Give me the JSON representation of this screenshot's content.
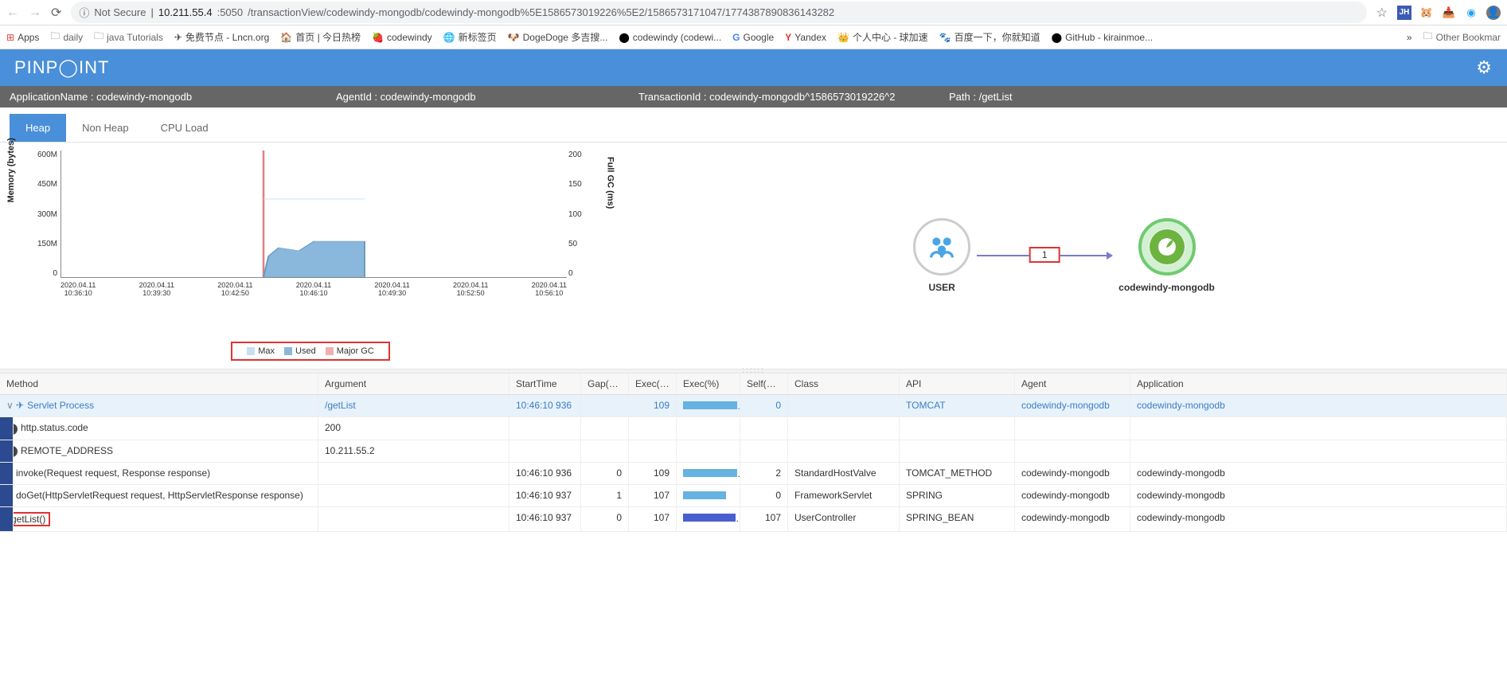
{
  "browser": {
    "not_secure": "Not Secure",
    "url_host": "10.211.55.4",
    "url_port": ":5050",
    "url_path": "/transactionView/codewindy-mongodb/codewindy-mongodb%5E1586573019226%5E2/1586573171047/1774387890836143282"
  },
  "bookmarks": {
    "apps": "Apps",
    "daily": "daily",
    "java": "java Tutorials",
    "free": "免费节点 - Lncn.org",
    "home": "首页 | 今日热榜",
    "codewindy": "codewindy",
    "newtab": "新标签页",
    "dogedoge": "DogeDoge 多吉搜...",
    "codewindy_gh": "codewindy (codewi...",
    "google": "Google",
    "yandex": "Yandex",
    "personal": "个人中心 - 球加速",
    "baidu": "百度一下，你就知道",
    "github": "GitHub - kirainmoe...",
    "other": "Other Bookmar"
  },
  "pp_logo": "PINP◯INT",
  "info": {
    "app_label": "ApplicationName : ",
    "app_value": "codewindy-mongodb",
    "agent_label": "AgentId : ",
    "agent_value": "codewindy-mongodb",
    "txn_label": "TransactionId : ",
    "txn_value": "codewindy-mongodb^1586573019226^2",
    "path_label": "Path : ",
    "path_value": "/getList"
  },
  "tabs": {
    "heap": "Heap",
    "nonheap": "Non Heap",
    "cpu": "CPU Load"
  },
  "chart_data": {
    "type": "area",
    "ylabel": "Memory (bytes)",
    "y2label": "Full GC (ms)",
    "y_ticks": [
      "600M",
      "450M",
      "300M",
      "150M",
      "0"
    ],
    "y2_ticks": [
      "200",
      "150",
      "100",
      "50",
      "0"
    ],
    "x_ticks": [
      {
        "d": "2020.04.11",
        "t": "10:36:10"
      },
      {
        "d": "2020.04.11",
        "t": "10:39:30"
      },
      {
        "d": "2020.04.11",
        "t": "10:42:50"
      },
      {
        "d": "2020.04.11",
        "t": "10:46:10"
      },
      {
        "d": "2020.04.11",
        "t": "10:49:30"
      },
      {
        "d": "2020.04.11",
        "t": "10:52:50"
      },
      {
        "d": "2020.04.11",
        "t": "10:56:10"
      }
    ],
    "series": [
      {
        "name": "Max",
        "color": "#c8dff2"
      },
      {
        "name": "Used",
        "color": "#8ab8dd"
      },
      {
        "name": "Major GC",
        "color": "#f0b0b0"
      }
    ],
    "used_approx": [
      {
        "x": 0.4,
        "y": 0
      },
      {
        "x": 0.41,
        "y": 100
      },
      {
        "x": 0.43,
        "y": 140
      },
      {
        "x": 0.47,
        "y": 125
      },
      {
        "x": 0.5,
        "y": 170
      },
      {
        "x": 0.6,
        "y": 170
      },
      {
        "x": 0.6,
        "y": 0
      }
    ],
    "ylim": [
      0,
      600
    ],
    "y2lim": [
      0,
      200
    ],
    "max_line_y": 370
  },
  "topo": {
    "user": "USER",
    "target": "codewindy-mongodb",
    "count": "1"
  },
  "table": {
    "headers": {
      "method": "Method",
      "argument": "Argument",
      "start": "StartTime",
      "gap": "Gap(ms)",
      "exms": "Exec(ms)",
      "exp": "Exec(%)",
      "self": "Self(ms)",
      "class": "Class",
      "api": "API",
      "agent": "Agent",
      "app": "Application"
    },
    "rows": [
      {
        "marker": "",
        "indent": 0,
        "caret": "∨",
        "icon": "plane",
        "method": "Servlet Process",
        "arg": "/getList",
        "start": "10:46:10 936",
        "gap": "",
        "exms": "109",
        "exp_w": 68,
        "exp_c": "#66b2e0",
        "self": "0",
        "class": "",
        "api": "TOMCAT",
        "agent": "codewindy-mongodb",
        "app": "codewindy-mongodb",
        "sel": true
      },
      {
        "marker": "blue",
        "indent": 1,
        "caret": "",
        "icon": "info",
        "method": "http.status.code",
        "arg": "200",
        "start": "",
        "gap": "",
        "exms": "",
        "exp_w": 0,
        "exp_c": "",
        "self": "",
        "class": "",
        "api": "",
        "agent": "",
        "app": ""
      },
      {
        "marker": "blue",
        "indent": 1,
        "caret": "",
        "icon": "info",
        "method": "REMOTE_ADDRESS",
        "arg": "10.211.55.2",
        "start": "",
        "gap": "",
        "exms": "",
        "exp_w": 0,
        "exp_c": "",
        "self": "",
        "class": "",
        "api": "",
        "agent": "",
        "app": ""
      },
      {
        "marker": "blue",
        "indent": 1,
        "caret": "∨",
        "icon": "",
        "method": "invoke(Request request, Response response)",
        "arg": "",
        "start": "10:46:10 936",
        "gap": "0",
        "exms": "109",
        "exp_w": 68,
        "exp_c": "#66b2e0",
        "self": "2",
        "class": "StandardHostValve",
        "api": "TOMCAT_METHOD",
        "agent": "codewindy-mongodb",
        "app": "codewindy-mongodb"
      },
      {
        "marker": "blue",
        "indent": 2,
        "caret": "∨",
        "icon": "",
        "method": "doGet(HttpServletRequest request, HttpServletResponse response)",
        "arg": "",
        "start": "10:46:10 937",
        "gap": "1",
        "exms": "107",
        "exp_w": 54,
        "exp_c": "#66b2e0",
        "self": "0",
        "class": "FrameworkServlet",
        "api": "SPRING",
        "agent": "codewindy-mongodb",
        "app": "codewindy-mongodb"
      },
      {
        "marker": "blue",
        "indent": 3,
        "caret": "",
        "icon": "",
        "method": "getList()",
        "hl": true,
        "arg": "",
        "start": "10:46:10 937",
        "gap": "0",
        "exms": "107",
        "exp_w": 66,
        "exp_c": "#4a5fcf",
        "self": "107",
        "class": "UserController",
        "api": "SPRING_BEAN",
        "agent": "codewindy-mongodb",
        "app": "codewindy-mongodb"
      }
    ]
  }
}
